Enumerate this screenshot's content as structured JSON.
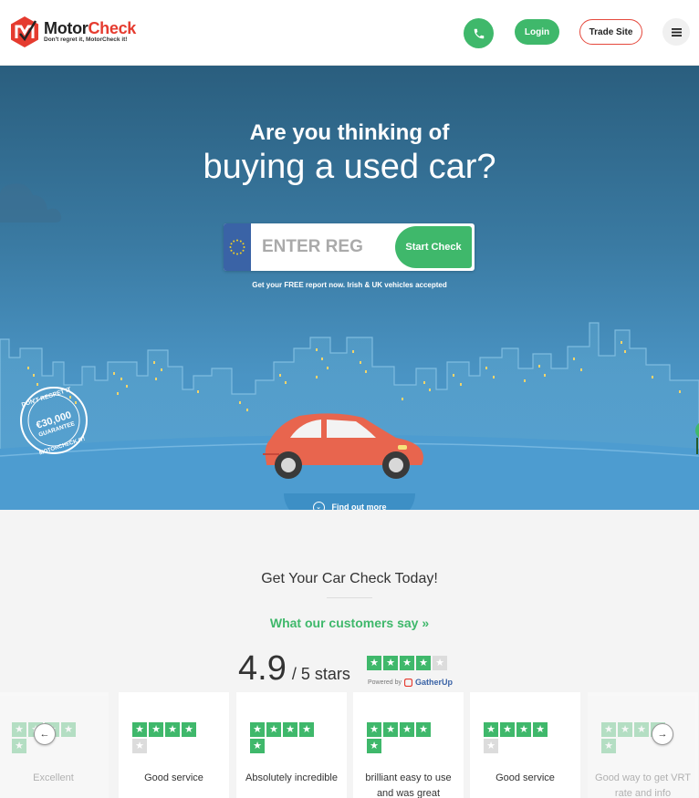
{
  "header": {
    "logo_name_1": "Motor",
    "logo_name_2": "Check",
    "logo_tagline": "Don't regret it, MotorCheck it!",
    "login_label": "Login",
    "trade_label": "Trade Site"
  },
  "hero": {
    "title_line1": "Are you thinking of",
    "title_line2": "buying a used car?",
    "reg_placeholder": "ENTER REG",
    "start_label": "Start Check",
    "subtitle": "Get your FREE report now. Irish & UK vehicles accepted",
    "badge_top": "DON'T REGRET IT",
    "badge_amount": "€30,000",
    "badge_guarantee": "GUARANTEE",
    "badge_bottom": "MOTORCHECK IT!",
    "find_more": "Find out more"
  },
  "section": {
    "title": "Get Your Car Check Today!",
    "customers_link": "What our customers say »"
  },
  "rating": {
    "score": "4.9",
    "out_of": "/ 5 stars",
    "stars": 4,
    "powered_by": "Powered by",
    "provider": "GatherUp"
  },
  "reviews": [
    {
      "text": "Excellent",
      "stars": 4
    },
    {
      "text": "Good service",
      "stars": 4
    },
    {
      "text": "Absolutely incredible",
      "stars": 5
    },
    {
      "text": "brilliant easy to use and was great",
      "stars": 5
    },
    {
      "text": "Good service",
      "stars": 4
    },
    {
      "text": "Good way to get VRT rate and info",
      "stars": 5
    }
  ],
  "colors": {
    "brand_red": "#e53b2f",
    "accent_green": "#3fb86b",
    "hero_blue": "#4d9cd0"
  }
}
